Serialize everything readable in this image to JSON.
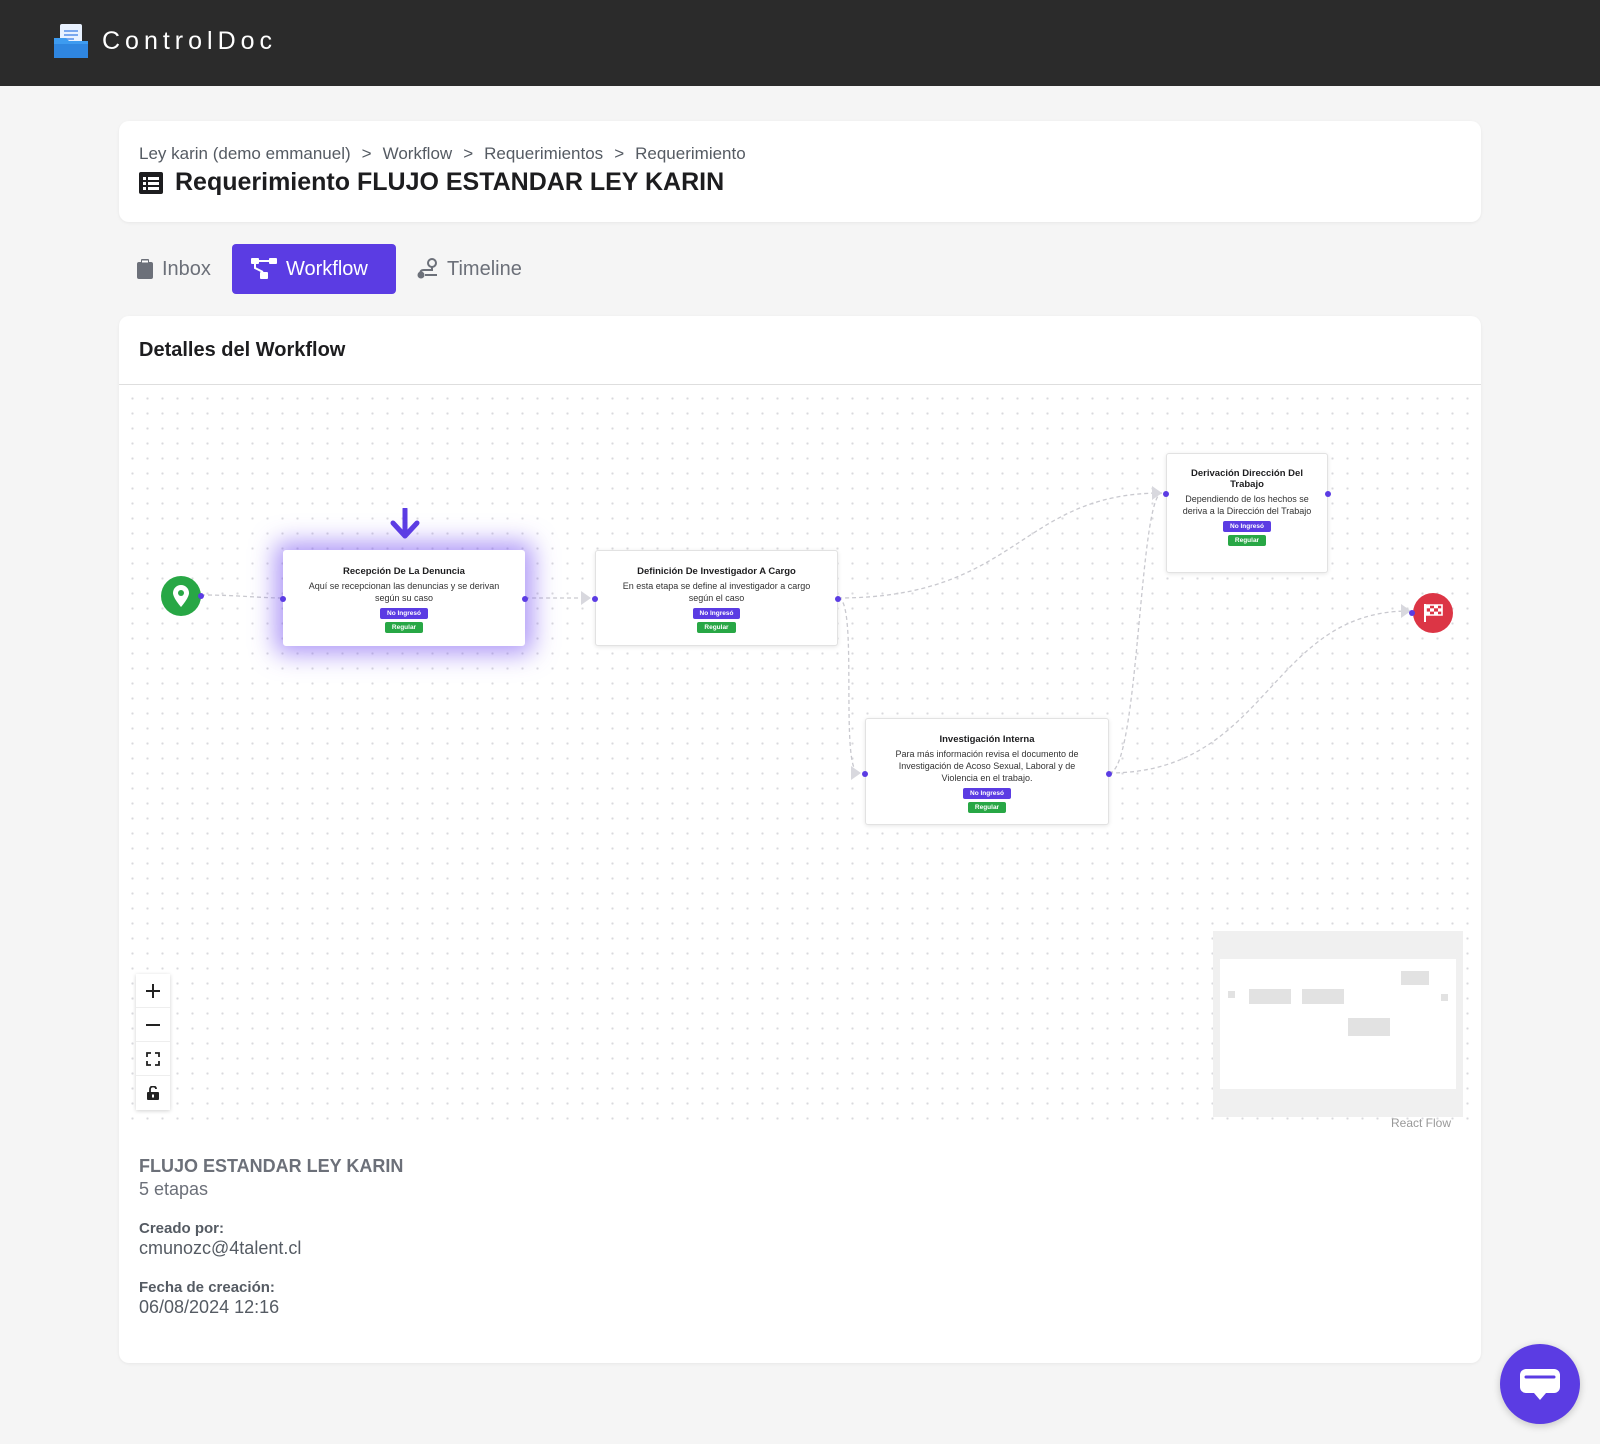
{
  "app": {
    "name": "ControlDoc"
  },
  "breadcrumb": [
    "Ley karin (demo emmanuel)",
    "Workflow",
    "Requerimientos",
    "Requerimiento"
  ],
  "breadcrumb_separator": ">",
  "page": {
    "title": "Requerimiento FLUJO ESTANDAR LEY KARIN"
  },
  "tabs": [
    {
      "label": "Inbox",
      "icon": "clipboard-icon",
      "active": false
    },
    {
      "label": "Workflow",
      "icon": "workflow-icon",
      "active": true
    },
    {
      "label": "Timeline",
      "icon": "route-icon",
      "active": false
    }
  ],
  "section": {
    "title": "Detalles del Workflow"
  },
  "nodes": [
    {
      "title": "Recepción De La Denuncia",
      "description": "Aquí se recepcionan las denuncias y se derivan según su caso",
      "status": "No Ingresó",
      "type": "Regular",
      "current": true
    },
    {
      "title": "Definición De Investigador A Cargo",
      "description": "En esta etapa se define al investigador a cargo según el caso",
      "status": "No Ingresó",
      "type": "Regular",
      "current": false
    },
    {
      "title": "Derivación Dirección Del Trabajo",
      "description": "Dependiendo de los hechos se deriva a la Dirección del Trabajo",
      "status": "No Ingresó",
      "type": "Regular",
      "current": false
    },
    {
      "title": "Investigación Interna",
      "description": "Para más información revisa el documento de Investigación de Acoso Sexual, Laboral y de Violencia en el trabajo.",
      "status": "No Ingresó",
      "type": "Regular",
      "current": false
    }
  ],
  "flow_controls": [
    "zoom-in",
    "zoom-out",
    "fit-view",
    "lock"
  ],
  "attribution": "React Flow",
  "workflow_info": {
    "name": "FLUJO ESTANDAR LEY KARIN",
    "stages": "5 etapas",
    "created_by_label": "Creado por:",
    "created_by": "cmunozc@4talent.cl",
    "created_date_label": "Fecha de creación:",
    "created_date": "06/08/2024 12:16"
  },
  "colors": {
    "primary": "#5b3ce3",
    "success": "#28a745",
    "danger": "#dc3545",
    "topbar": "#2b2b2b"
  }
}
